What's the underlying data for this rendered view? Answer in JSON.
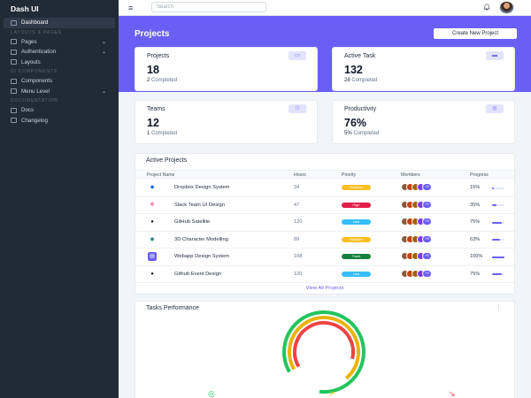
{
  "sidebar": {
    "brand": "Dash UI",
    "active_item": "Dashboard",
    "heading_layouts": "LAYOUTS & PAGES",
    "items_group1": [
      {
        "label": "Pages",
        "icon": "file-icon",
        "chevron": "⌄"
      },
      {
        "label": "Authentication",
        "icon": "lock-icon",
        "chevron": "⌄"
      },
      {
        "label": "Layouts",
        "icon": "layout-icon",
        "chevron": ""
      }
    ],
    "heading_components": "UI COMPONENTS",
    "items_group2": [
      {
        "label": "Components",
        "icon": "layers-icon",
        "chevron": ""
      },
      {
        "label": "Menu Level",
        "icon": "menu-level-icon",
        "chevron": "⌄"
      }
    ],
    "heading_docs": "DOCUMENTATION",
    "items_group3": [
      {
        "label": "Docs",
        "icon": "docs-icon",
        "chevron": ""
      },
      {
        "label": "Changelog",
        "icon": "changelog-icon",
        "chevron": ""
      }
    ]
  },
  "topbar": {
    "search_placeholder": "Search",
    "menu_glyph": "≡",
    "bell_glyph": "🔔"
  },
  "banner": {
    "title": "Projects",
    "create_label": "Create New Project",
    "color": "#6a5ff5"
  },
  "stats": [
    {
      "title": "Projects",
      "value": "18",
      "sub_num": "2",
      "sub_text": "Completed",
      "icon": "briefcase-icon",
      "glyph": "▭"
    },
    {
      "title": "Active Task",
      "value": "132",
      "sub_num": "28",
      "sub_text": "Completed",
      "icon": "list-icon",
      "glyph": "▬"
    },
    {
      "title": "Teams",
      "value": "12",
      "sub_num": "1",
      "sub_text": "Completed",
      "icon": "people-icon",
      "glyph": "⚇"
    },
    {
      "title": "Productivity",
      "value": "76%",
      "sub_num": "5%",
      "sub_text": "Completed",
      "icon": "target-icon",
      "glyph": "◎"
    }
  ],
  "active_projects": {
    "title": "Active Projects",
    "headers": [
      "Project Name",
      "Hours",
      "Priority",
      "Members",
      "Progress"
    ],
    "rows": [
      {
        "name": "Dropbox Design System",
        "hours": "34",
        "priority": "Medium",
        "priority_color": "#fbbf24",
        "progress": "15%",
        "progress_value": 0.15,
        "logo": "dropbox-icon",
        "logo_glyph": "◆",
        "logo_color": "#2563eb",
        "logo_bg": "#ffffff"
      },
      {
        "name": "Slack Team UI Design",
        "hours": "47",
        "priority": "High",
        "priority_color": "#e11d48",
        "progress": "35%",
        "progress_value": 0.35,
        "logo": "slack-icon",
        "logo_glyph": "✣",
        "logo_color": "#e01e5a",
        "logo_bg": "#ffffff"
      },
      {
        "name": "GitHub Satellite",
        "hours": "120",
        "priority": "Low",
        "priority_color": "#38bdf8",
        "progress": "75%",
        "progress_value": 0.75,
        "logo": "github-icon",
        "logo_glyph": "●",
        "logo_color": "#111827",
        "logo_bg": "#ffffff"
      },
      {
        "name": "3D Character Modelling",
        "hours": "89",
        "priority": "Medium",
        "priority_color": "#fbbf24",
        "progress": "63%",
        "progress_value": 0.63,
        "logo": "circle-logo-icon",
        "logo_glyph": "◉",
        "logo_color": "#0f766e",
        "logo_bg": "#ffffff"
      },
      {
        "name": "Webapp Design System",
        "hours": "108",
        "priority": "Track",
        "priority_color": "#15803d",
        "progress": "100%",
        "progress_value": 1.0,
        "logo": "layers-logo-icon",
        "logo_glyph": "▤",
        "logo_color": "#ffffff",
        "logo_bg": "#6a5ff5"
      },
      {
        "name": "Github Event Design",
        "hours": "120",
        "priority": "Low",
        "priority_color": "#38bdf8",
        "progress": "75%",
        "progress_value": 0.75,
        "logo": "github-icon",
        "logo_glyph": "●",
        "logo_color": "#111827",
        "logo_bg": "#ffffff"
      }
    ],
    "member_more": "+5",
    "view_all": "View All Projects"
  },
  "tasks": {
    "title": "Tasks Performance",
    "more_glyph": "⋮",
    "rings": [
      {
        "color": "#22c55e",
        "fraction": 0.85
      },
      {
        "color": "#eab308",
        "fraction": 0.72
      },
      {
        "color": "#ef4444",
        "fraction": 0.62
      }
    ],
    "legend_icons": [
      {
        "icon": "check-circle-icon",
        "glyph": "◎",
        "color": "#22c55e"
      },
      {
        "icon": "trending-up-icon",
        "glyph": "↗",
        "color": "#eab308"
      },
      {
        "icon": "trending-down-icon",
        "glyph": "↘",
        "color": "#ef4444"
      }
    ]
  }
}
